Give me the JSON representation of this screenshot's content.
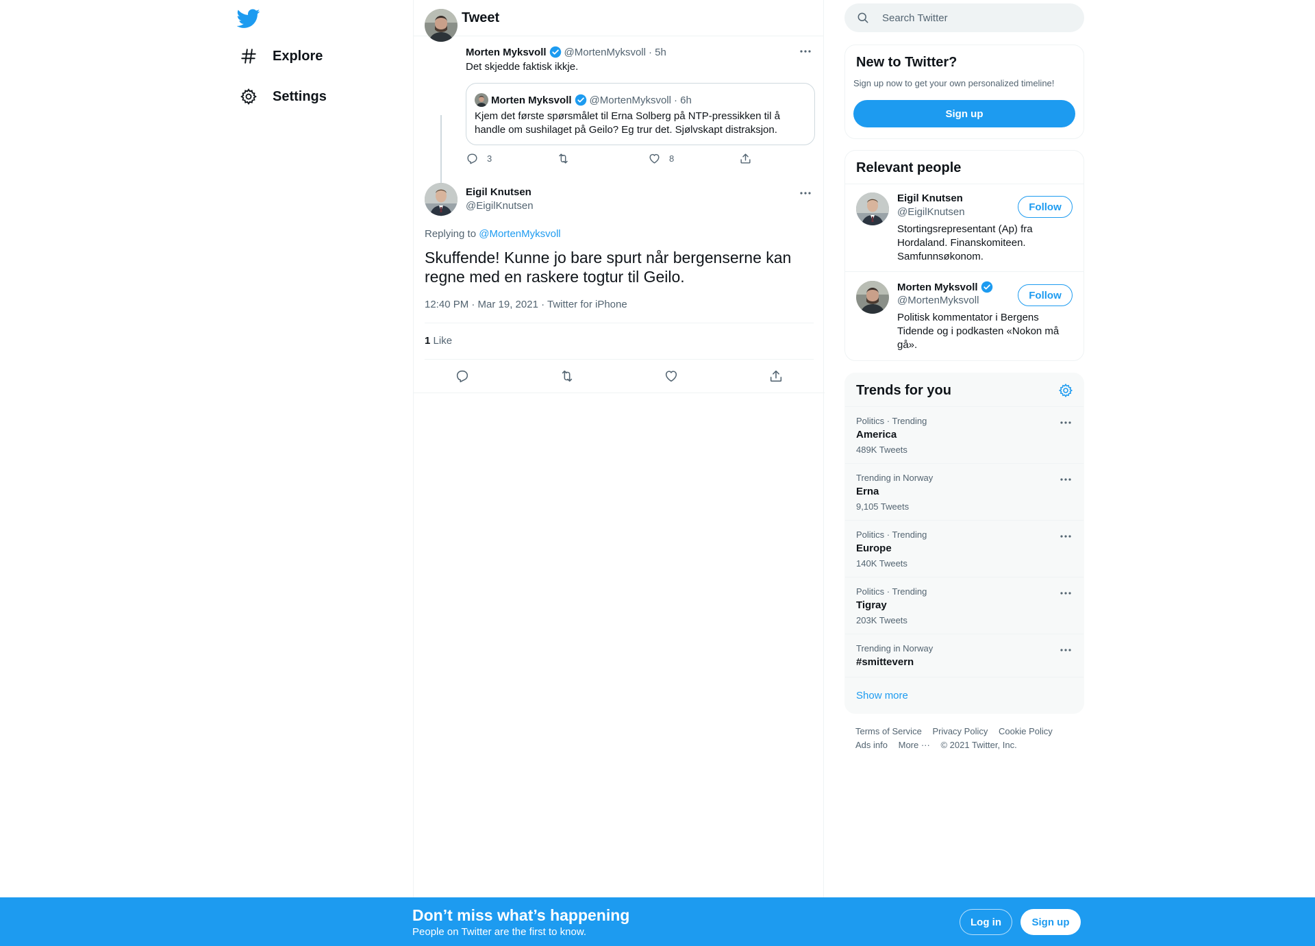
{
  "colors": {
    "accent": "#1d9bf0",
    "text": "#0f1419",
    "muted": "#536471",
    "border": "#eff3f4"
  },
  "nav": {
    "logo_icon": "twitter-bird-icon",
    "items": [
      {
        "label": "Explore",
        "icon": "hashtag-icon"
      },
      {
        "label": "Settings",
        "icon": "gear-icon"
      }
    ]
  },
  "header": {
    "title": "Tweet"
  },
  "tweet": {
    "author_name": "Morten Myksvoll",
    "author_handle": "@MortenMyksvoll",
    "time": "· 5h",
    "text": "Det skjedde faktisk ikkje.",
    "quote": {
      "author_name": "Morten Myksvoll",
      "author_handle": "@MortenMyksvoll",
      "time": "· 6h",
      "text": "Kjem det første spørsmålet til Erna Solberg på NTP-pressikken til å handle om sushilaget på Geilo? Eg trur det. Sjølvskapt distraksjon."
    },
    "replies": "3",
    "retweets": "",
    "likes": "8"
  },
  "reply": {
    "author_name": "Eigil Knutsen",
    "author_handle": "@EigilKnutsen",
    "replying_prefix": "Replying to",
    "replying_to": "@MortenMyksvoll",
    "text": "Skuffende! Kunne jo bare spurt når bergenserne kan regne med en raskere togtur til Geilo.",
    "meta": "12:40 PM · Mar 19, 2021 · Twitter for iPhone",
    "like_count": "1",
    "like_label": "Like"
  },
  "search": {
    "placeholder": "Search Twitter"
  },
  "new_to_twitter": {
    "title": "New to Twitter?",
    "subtitle": "Sign up now to get your own personalized timeline!",
    "button": "Sign up"
  },
  "relevant_people": {
    "title": "Relevant people",
    "people": [
      {
        "name": "Eigil Knutsen",
        "handle": "@EigilKnutsen",
        "bio": "Stortingsrepresentant (Ap) fra Hordaland. Finanskomiteen. Samfunnsøkonom.",
        "follow": "Follow"
      },
      {
        "name": "Morten Myksvoll",
        "handle": "@MortenMyksvoll",
        "bio": "Politisk kommentator i Bergens Tidende og i podkasten «Nokon må gå».",
        "follow": "Follow"
      }
    ]
  },
  "trends": {
    "title": "Trends for you",
    "items": [
      {
        "meta": "Politics · Trending",
        "name": "America",
        "count": "489K Tweets"
      },
      {
        "meta": "Trending in Norway",
        "name": "Erna",
        "count": "9,105 Tweets"
      },
      {
        "meta": "Politics · Trending",
        "name": "Europe",
        "count": "140K Tweets"
      },
      {
        "meta": "Politics · Trending",
        "name": "Tigray",
        "count": "203K Tweets"
      },
      {
        "meta": "Trending in Norway",
        "name": "#smittevern",
        "count": ""
      }
    ],
    "show_more": "Show more"
  },
  "footer": {
    "links": [
      "Terms of Service",
      "Privacy Policy",
      "Cookie Policy",
      "Ads info",
      "More ···"
    ],
    "copyright": "© 2021 Twitter, Inc."
  },
  "bottom_bar": {
    "title": "Don’t miss what’s happening",
    "subtitle": "People on Twitter are the first to know.",
    "login": "Log in",
    "signup": "Sign up"
  }
}
